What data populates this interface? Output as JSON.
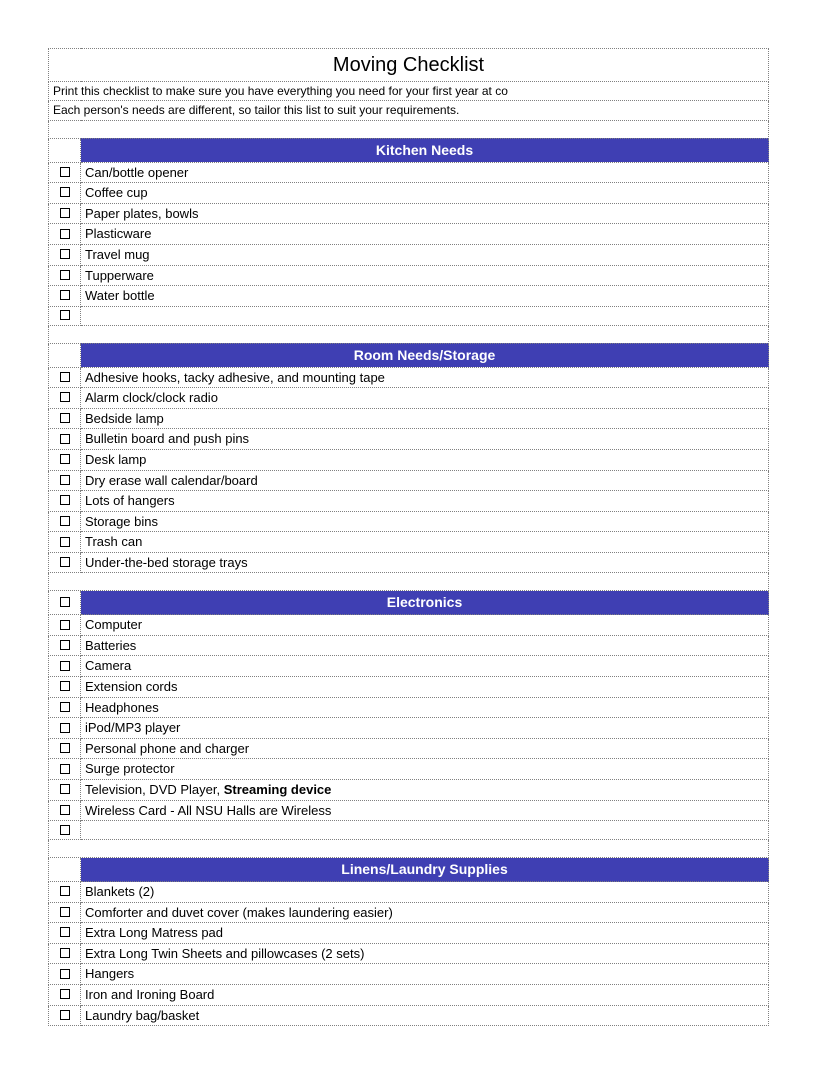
{
  "title": "Moving Checklist",
  "intro": [
    "Print this checklist to make sure you have everything you need for your first year at co",
    "Each person's needs are different, so tailor this list to suit your requirements."
  ],
  "sections": [
    {
      "name": "Kitchen Needs",
      "top_checkbox": false,
      "items": [
        "Can/bottle opener",
        "Coffee cup",
        "Paper plates, bowls",
        "Plasticware",
        "Travel mug",
        "Tupperware",
        "Water bottle",
        ""
      ]
    },
    {
      "name": "Room Needs/Storage",
      "top_checkbox": false,
      "items": [
        "Adhesive hooks, tacky adhesive, and mounting tape",
        "Alarm clock/clock radio",
        "Bedside lamp",
        "Bulletin board and push pins",
        "Desk lamp",
        "Dry erase wall calendar/board",
        "Lots of hangers",
        "Storage bins",
        "Trash can",
        "Under-the-bed storage trays"
      ]
    },
    {
      "name": "Electronics",
      "top_checkbox": true,
      "items": [
        "Computer",
        "Batteries",
        "Camera",
        "Extension cords",
        "Headphones",
        "iPod/MP3 player",
        "Personal phone and charger",
        "Surge protector",
        {
          "text": "Television, DVD Player, ",
          "bold_suffix": "Streaming device"
        },
        "Wireless Card - All NSU Halls are Wireless",
        ""
      ]
    },
    {
      "name": "Linens/Laundry Supplies",
      "top_checkbox": false,
      "items": [
        "Blankets (2)",
        "Comforter and duvet cover (makes laundering easier)",
        "Extra Long Matress pad",
        "Extra Long Twin Sheets and pillowcases (2 sets)",
        "Hangers",
        "Iron and Ironing Board",
        "Laundry bag/basket"
      ]
    }
  ]
}
